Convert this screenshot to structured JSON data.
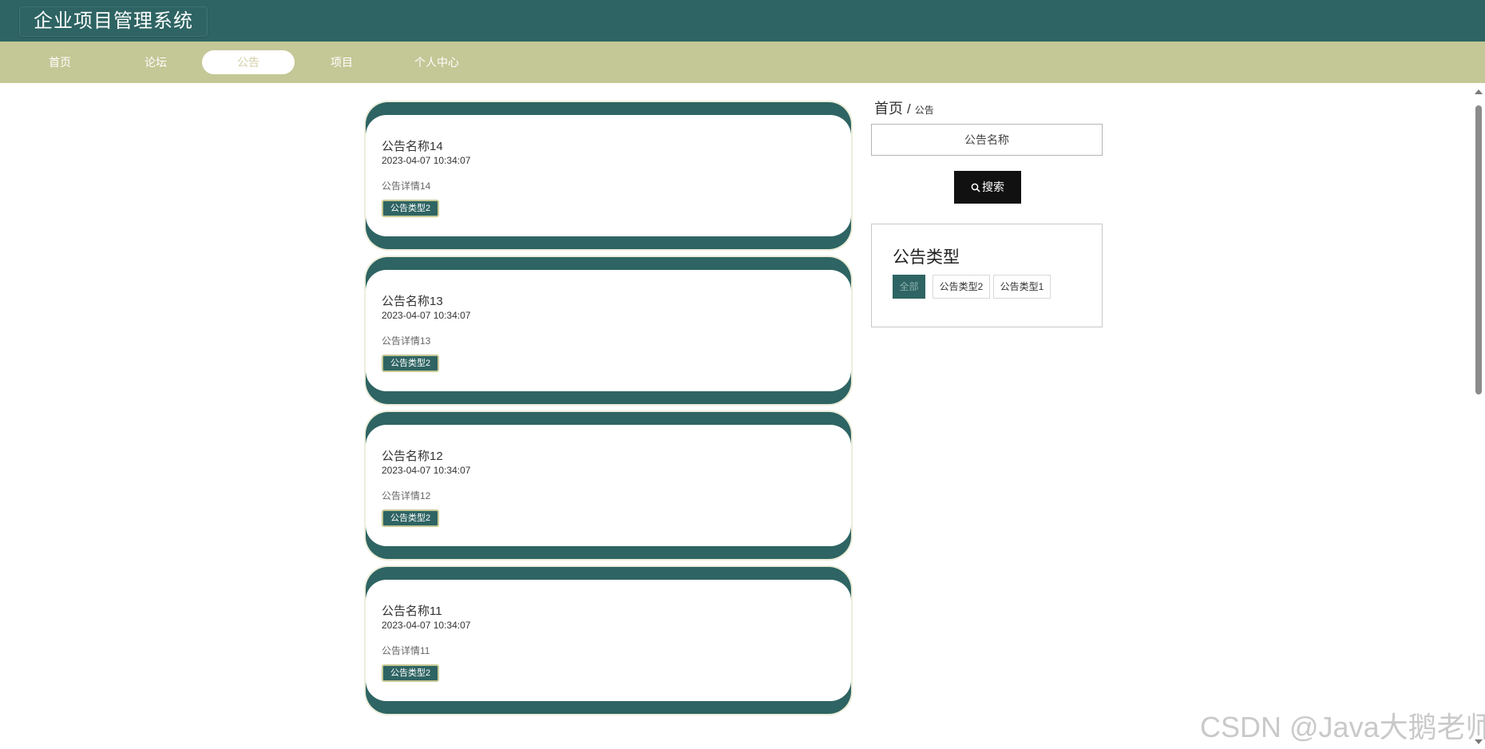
{
  "header": {
    "title": "企业项目管理系统",
    "color": "#2e6463"
  },
  "nav": {
    "color": "#c4c796",
    "items": [
      {
        "label": "首页",
        "active": false
      },
      {
        "label": "论坛",
        "active": false
      },
      {
        "label": "公告",
        "active": true
      },
      {
        "label": "项目",
        "active": false
      },
      {
        "label": "个人中心",
        "active": false
      }
    ]
  },
  "notices": [
    {
      "title": "公告名称14",
      "time": "2023-04-07 10:34:07",
      "detail": "公告详情14",
      "type": "公告类型2"
    },
    {
      "title": "公告名称13",
      "time": "2023-04-07 10:34:07",
      "detail": "公告详情13",
      "type": "公告类型2"
    },
    {
      "title": "公告名称12",
      "time": "2023-04-07 10:34:07",
      "detail": "公告详情12",
      "type": "公告类型2"
    },
    {
      "title": "公告名称11",
      "time": "2023-04-07 10:34:07",
      "detail": "公告详情11",
      "type": "公告类型2"
    }
  ],
  "breadcrumb": {
    "home": "首页",
    "separator": "/",
    "current": "公告"
  },
  "search": {
    "placeholder": "公告名称",
    "button_label": "搜索",
    "icon": "search-icon"
  },
  "type_filter": {
    "title": "公告类型",
    "options": [
      {
        "label": "全部",
        "active": true
      },
      {
        "label": "公告类型2",
        "active": false
      },
      {
        "label": "公告类型1",
        "active": false
      }
    ]
  },
  "watermark": "CSDN @Java大鹅老师"
}
